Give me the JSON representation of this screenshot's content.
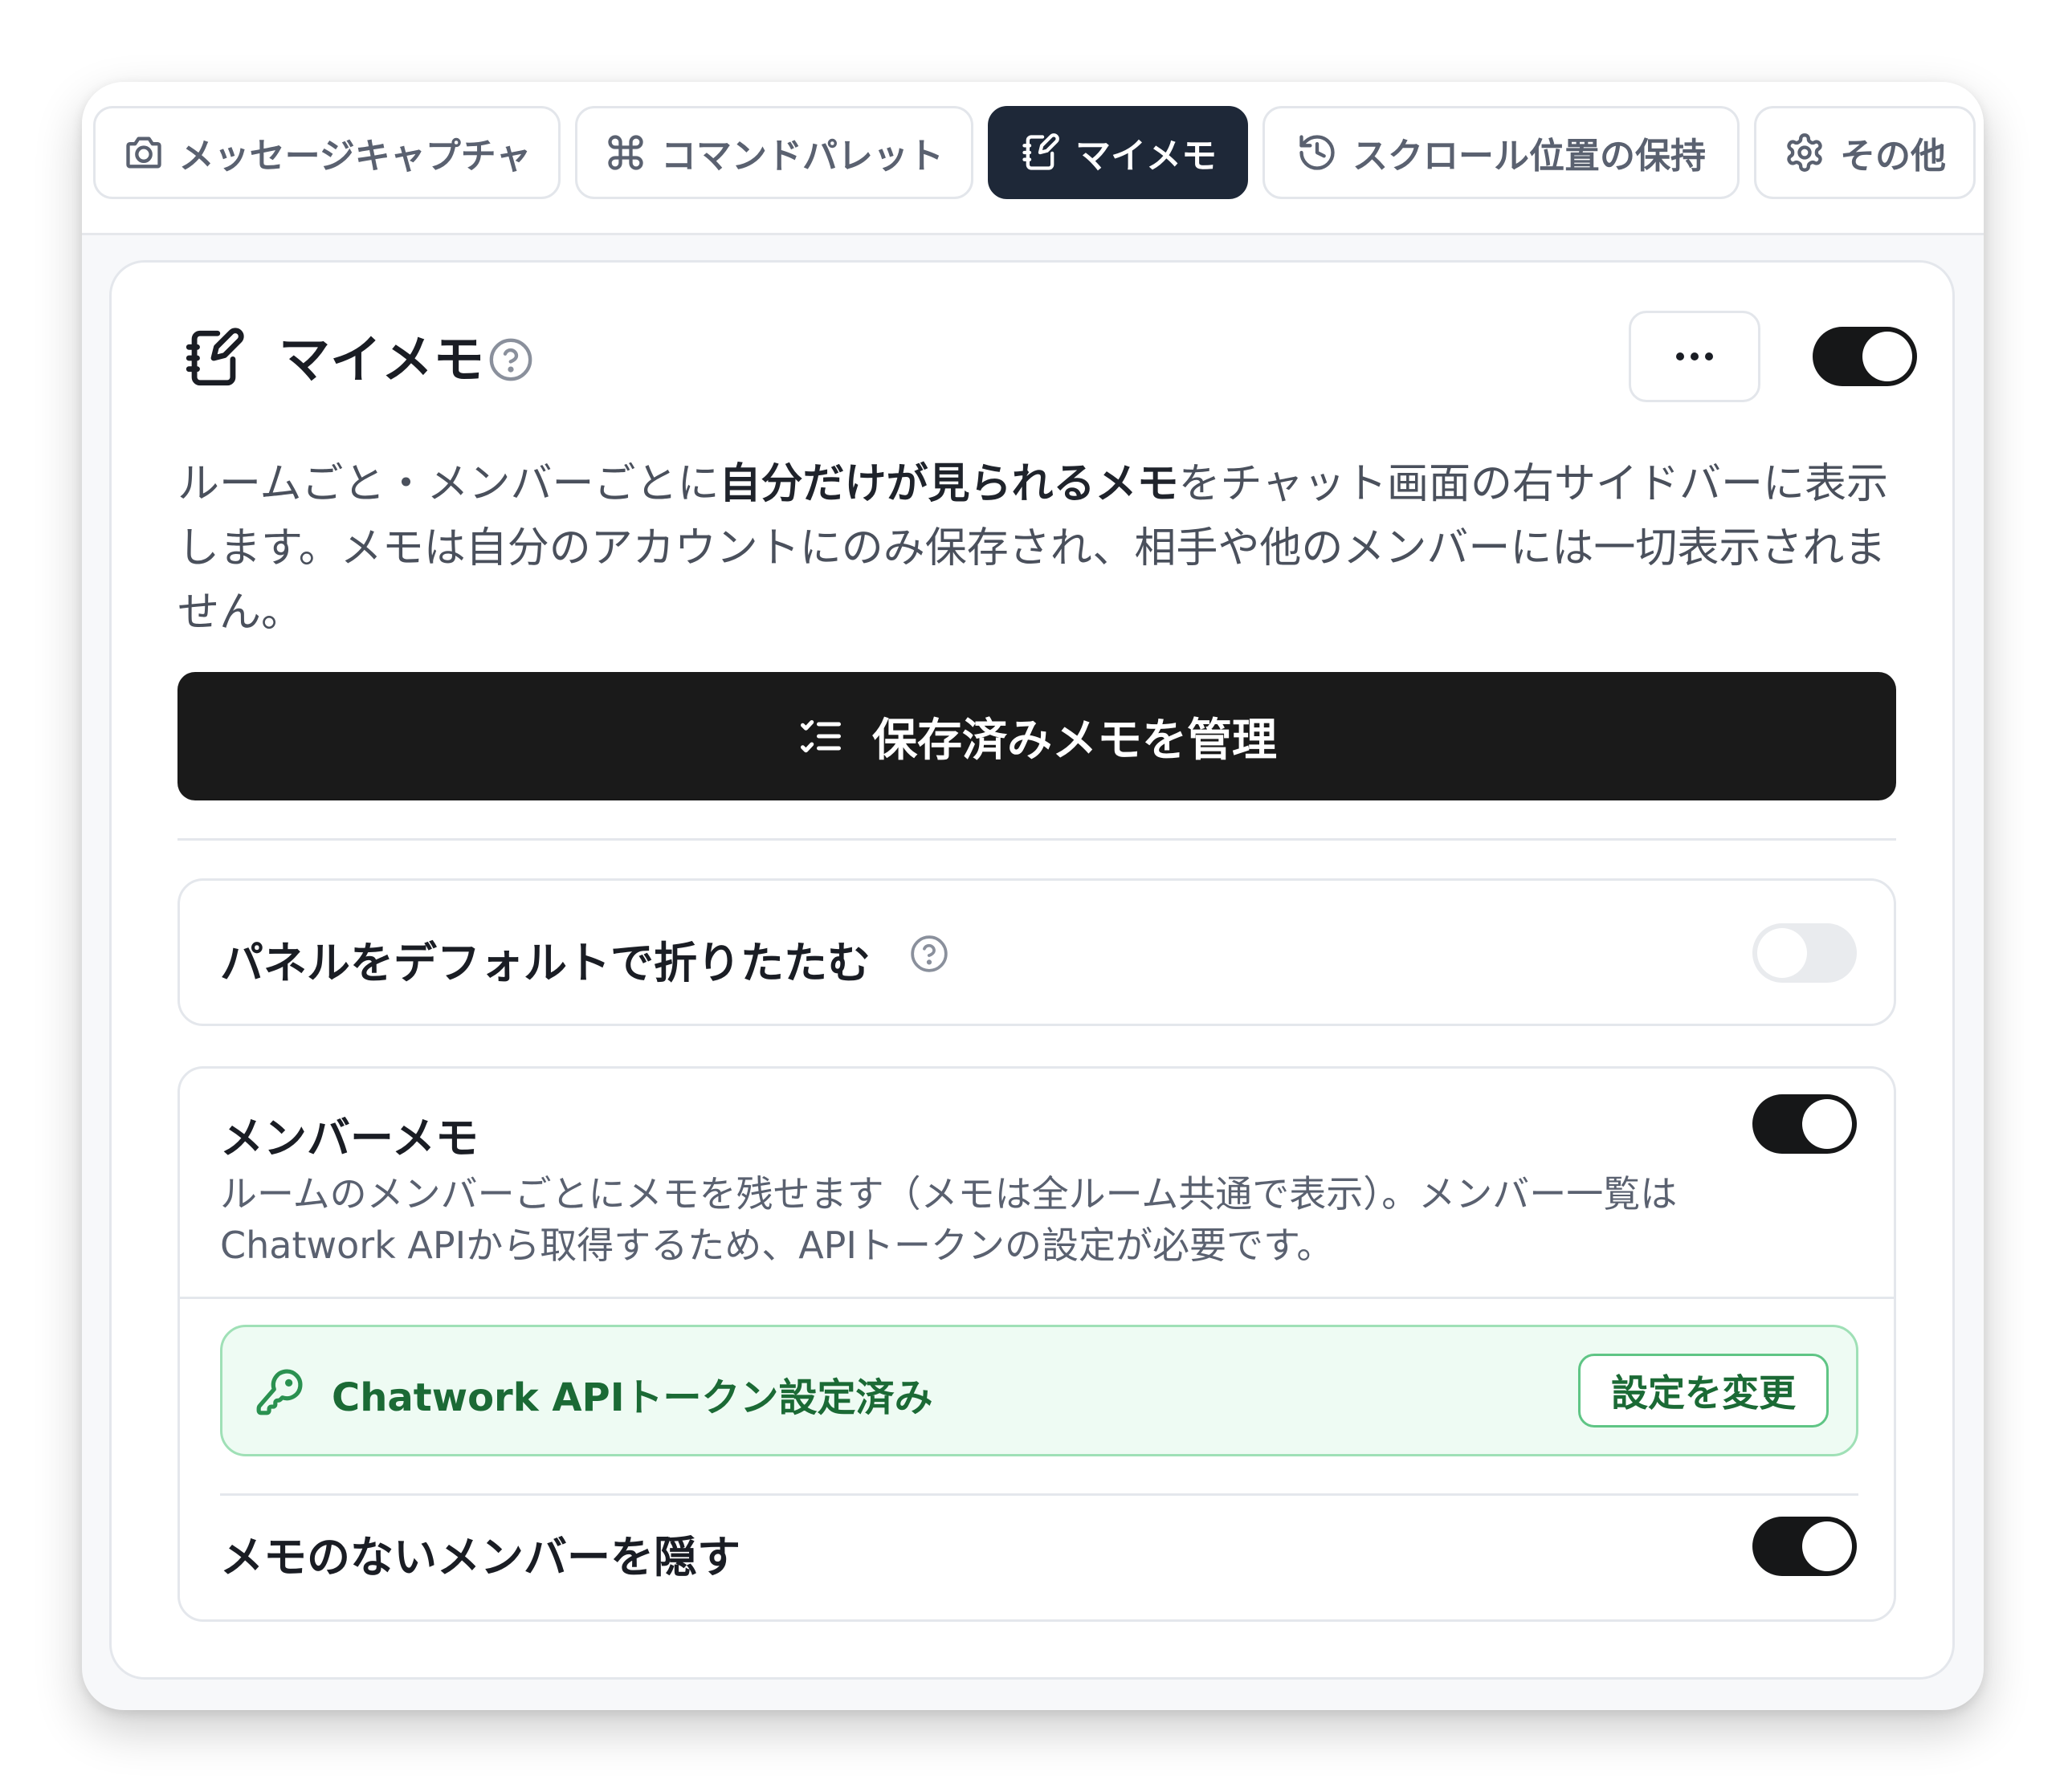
{
  "tabs": [
    {
      "label": "メッセージキャプチャ",
      "icon": "camera-icon"
    },
    {
      "label": "コマンドパレット",
      "icon": "command-icon"
    },
    {
      "label": "マイメモ",
      "icon": "note-edit-icon",
      "active": true
    },
    {
      "label": "スクロール位置の保持",
      "icon": "history-icon"
    },
    {
      "label": "その他",
      "icon": "gear-icon"
    }
  ],
  "card": {
    "title": "マイメモ",
    "enabled": true,
    "description": {
      "before": "ルームごと・メンバーごとに",
      "bold": "自分だけが見られるメモ",
      "after": "をチャット画面の右サイドバーに表示します。メモは自分のアカウントにのみ保存され、相手や他のメンバーには一切表示されません。"
    },
    "manage_button": "保存済みメモを管理"
  },
  "collapse_setting": {
    "label": "パネルをデフォルトで折りたたむ",
    "enabled": false
  },
  "member_memo": {
    "label": "メンバーメモ",
    "enabled": true,
    "description": "ルームのメンバーごとにメモを残せます（メモは全ルーム共通で表示）。メンバー一覧はChatwork APIから取得するため、APIトークンの設定が必要です。",
    "token_status": "Chatwork APIトークン設定済み",
    "change_button": "設定を変更",
    "hide_without_memo": {
      "label": "メモのないメンバーを隠す",
      "enabled": true
    }
  },
  "colors": {
    "active_tab": "#1e2838",
    "toggle_on": "#161718",
    "toggle_off": "#e9ebee",
    "success_text": "#1b6a35",
    "success_bg": "#eefbf3",
    "success_border": "#9fe0b6"
  }
}
